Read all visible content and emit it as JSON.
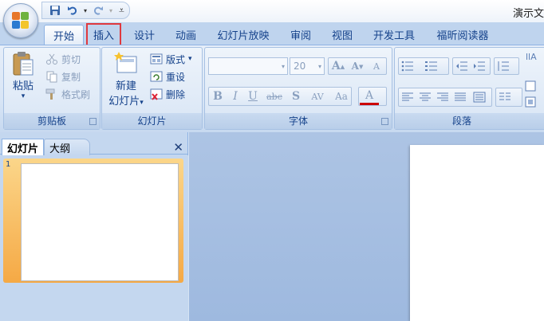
{
  "app": {
    "title": "演示文"
  },
  "quick_access": {
    "save_icon": "save-icon",
    "undo_icon": "undo-icon",
    "redo_icon": "redo-icon",
    "customize_glyph": "▾"
  },
  "tabs": [
    {
      "label": "开始",
      "active": true,
      "highlighted": false
    },
    {
      "label": "插入",
      "active": false,
      "highlighted": true
    },
    {
      "label": "设计",
      "active": false,
      "highlighted": false
    },
    {
      "label": "动画",
      "active": false,
      "highlighted": false
    },
    {
      "label": "幻灯片放映",
      "active": false,
      "highlighted": false
    },
    {
      "label": "审阅",
      "active": false,
      "highlighted": false
    },
    {
      "label": "视图",
      "active": false,
      "highlighted": false
    },
    {
      "label": "开发工具",
      "active": false,
      "highlighted": false
    },
    {
      "label": "福昕阅读器",
      "active": false,
      "highlighted": false
    }
  ],
  "ribbon": {
    "clipboard": {
      "group_label": "剪贴板",
      "paste_label": "粘贴",
      "paste_arrow": "▾",
      "cut_label": "剪切",
      "copy_label": "复制",
      "format_painter_label": "格式刷",
      "launcher": "↘"
    },
    "slides": {
      "group_label": "幻灯片",
      "new_slide_label_1": "新建",
      "new_slide_label_2": "幻灯片",
      "new_slide_arrow": "▾",
      "layout_label": "版式",
      "layout_arrow": "▾",
      "reset_label": "重设",
      "delete_label": "删除"
    },
    "font": {
      "group_label": "字体",
      "font_name_value": "",
      "font_size_value": "20",
      "grow_label": "A",
      "shrink_label": "A",
      "clear_label": "A",
      "bold_label": "B",
      "italic_label": "I",
      "underline_label": "U",
      "strike_label": "abc",
      "shadow_label": "S",
      "spacing_label": "AV",
      "case_label": "Aa",
      "color_label": "A",
      "launcher": "↘"
    },
    "paragraph": {
      "group_label": "段落"
    }
  },
  "left_pane": {
    "tab_slides": "幻灯片",
    "tab_outline": "大纲",
    "close_glyph": "✕",
    "thumbnail_number": "1"
  },
  "colors": {
    "ribbon_bg": "#d9e6f6",
    "tab_text": "#15428b",
    "highlight_border": "#e0393e",
    "thumb_selected": "#f5a945",
    "workarea_bg": "#adc4e4"
  }
}
